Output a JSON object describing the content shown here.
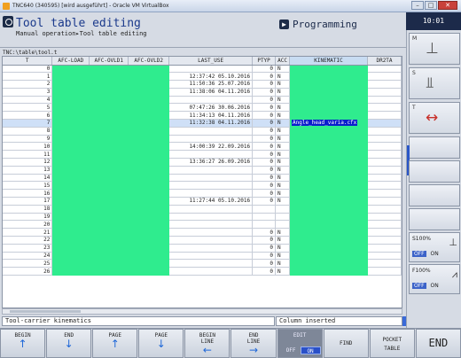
{
  "window": {
    "title": "TNC640 (340595) [wird ausgeführt] - Oracle VM VirtualBox"
  },
  "header": {
    "title": "Tool table editing",
    "breadcrumb": "Manual operation▸Tool table editing",
    "mode": "Programming",
    "clock": "10:01"
  },
  "file_path": "TNC:\\table\\tool.t",
  "table": {
    "columns": [
      "T",
      "AFC-LOAD",
      "AFC-OVLD1",
      "AFC-OVLD2",
      "LAST_USE",
      "PTYP",
      "ACC",
      "KINEMATIC",
      "DR2TA"
    ],
    "rows": [
      {
        "t": "0",
        "last_use": "",
        "ptyp": "0",
        "acc": "N",
        "kinematic": ""
      },
      {
        "t": "1",
        "last_use": "12:37:42 05.10.2016",
        "ptyp": "0",
        "acc": "N",
        "kinematic": ""
      },
      {
        "t": "2",
        "last_use": "11:50:36 25.07.2016",
        "ptyp": "0",
        "acc": "N",
        "kinematic": ""
      },
      {
        "t": "3",
        "last_use": "11:38:06 04.11.2016",
        "ptyp": "0",
        "acc": "N",
        "kinematic": ""
      },
      {
        "t": "4",
        "last_use": "",
        "ptyp": "0",
        "acc": "N",
        "kinematic": ""
      },
      {
        "t": "5",
        "last_use": "07:47:26 30.06.2016",
        "ptyp": "0",
        "acc": "N",
        "kinematic": ""
      },
      {
        "t": "6",
        "last_use": "11:34:13 04.11.2016",
        "ptyp": "0",
        "acc": "N",
        "kinematic": ""
      },
      {
        "t": "7",
        "last_use": "11:32:38 04.11.2016",
        "ptyp": "0",
        "acc": "N",
        "kinematic": "Angle_head_varia.cfx"
      },
      {
        "t": "8",
        "last_use": "",
        "ptyp": "0",
        "acc": "N",
        "kinematic": ""
      },
      {
        "t": "9",
        "last_use": "",
        "ptyp": "0",
        "acc": "N",
        "kinematic": ""
      },
      {
        "t": "10",
        "last_use": "14:00:39 22.09.2016",
        "ptyp": "0",
        "acc": "N",
        "kinematic": ""
      },
      {
        "t": "11",
        "last_use": "",
        "ptyp": "0",
        "acc": "N",
        "kinematic": ""
      },
      {
        "t": "12",
        "last_use": "13:36:27 26.09.2016",
        "ptyp": "0",
        "acc": "N",
        "kinematic": ""
      },
      {
        "t": "13",
        "last_use": "",
        "ptyp": "0",
        "acc": "N",
        "kinematic": ""
      },
      {
        "t": "14",
        "last_use": "",
        "ptyp": "0",
        "acc": "N",
        "kinematic": ""
      },
      {
        "t": "15",
        "last_use": "",
        "ptyp": "0",
        "acc": "N",
        "kinematic": ""
      },
      {
        "t": "16",
        "last_use": "",
        "ptyp": "0",
        "acc": "N",
        "kinematic": ""
      },
      {
        "t": "17",
        "last_use": "11:27:44 05.10.2016",
        "ptyp": "0",
        "acc": "N",
        "kinematic": ""
      },
      {
        "t": "18",
        "last_use": "",
        "ptyp": "",
        "acc": "",
        "kinematic": ""
      },
      {
        "t": "19",
        "last_use": "",
        "ptyp": "",
        "acc": "",
        "kinematic": ""
      },
      {
        "t": "20",
        "last_use": "",
        "ptyp": "",
        "acc": "",
        "kinematic": ""
      },
      {
        "t": "21",
        "last_use": "",
        "ptyp": "0",
        "acc": "N",
        "kinematic": ""
      },
      {
        "t": "22",
        "last_use": "",
        "ptyp": "0",
        "acc": "N",
        "kinematic": ""
      },
      {
        "t": "23",
        "last_use": "",
        "ptyp": "0",
        "acc": "N",
        "kinematic": ""
      },
      {
        "t": "24",
        "last_use": "",
        "ptyp": "0",
        "acc": "N",
        "kinematic": ""
      },
      {
        "t": "25",
        "last_use": "",
        "ptyp": "0",
        "acc": "N",
        "kinematic": ""
      },
      {
        "t": "26",
        "last_use": "",
        "ptyp": "0",
        "acc": "N",
        "kinematic": ""
      }
    ],
    "selected_row": 7
  },
  "status": {
    "left": "Tool-carrier kinematics",
    "right": "Column inserted"
  },
  "softkeys": [
    {
      "line1": "BEGIN",
      "line2": "",
      "arrow": "up",
      "icon": "begin-up-icon"
    },
    {
      "line1": "END",
      "line2": "",
      "arrow": "down",
      "icon": "end-down-icon"
    },
    {
      "line1": "PAGE",
      "line2": "",
      "arrow": "up",
      "icon": "page-up-icon"
    },
    {
      "line1": "PAGE",
      "line2": "",
      "arrow": "down",
      "icon": "page-down-icon"
    },
    {
      "line1": "BEGIN",
      "line2": "LINE",
      "arrow": "left",
      "icon": "begin-line-icon"
    },
    {
      "line1": "END",
      "line2": "LINE",
      "arrow": "right",
      "icon": "end-line-icon"
    },
    {
      "line1": "EDIT",
      "line2": "",
      "toggle_off": "OFF",
      "toggle_on": "ON",
      "icon": "edit-toggle-icon"
    },
    {
      "line1": "FIND",
      "line2": "",
      "icon": "find-icon"
    },
    {
      "line1": "POCKET",
      "line2": "TABLE",
      "icon": "pocket-table-icon"
    },
    {
      "line1": "END",
      "line2": "",
      "icon": "end-key-icon"
    }
  ],
  "sidebar": {
    "m_label": "M",
    "s_label": "S",
    "t_label": "T",
    "s_override": {
      "value": "S100%",
      "off": "OFF",
      "on": "ON"
    },
    "f_override": {
      "value": "F100%",
      "off": "OFF",
      "on": "ON"
    }
  },
  "colors": {
    "green": "#2fec8e",
    "highlight": "#0a1ecc",
    "accent": "#1e67d8"
  }
}
